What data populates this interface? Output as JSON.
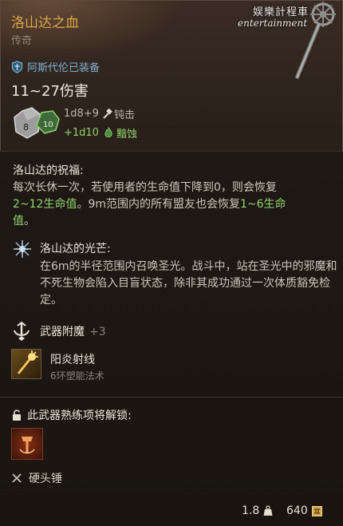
{
  "item": {
    "name": "洛山达之血",
    "rarity": "传奇",
    "equipped_text": "阿斯代伦已装备",
    "damage_range": "11~27伤害",
    "damage_lines": [
      {
        "dice": "1d8+9",
        "type": "钝击",
        "icon": "hammer-icon"
      },
      {
        "dice": "+1d10",
        "type": "黯蚀",
        "icon": "necrotic-flame-icon"
      }
    ]
  },
  "watermark": {
    "line1": "娱樂計程車",
    "line2": "entertainment"
  },
  "blessing": {
    "title": "洛山达的祝福:",
    "text_1": "每次长休一次，若使用者的生命值下降到0，则会恢复",
    "heal_1": "2~12生命值",
    "text_2": "。9m范围内的所有盟友也会恢复",
    "heal_2": "1~6生命值",
    "text_3": "。"
  },
  "aura": {
    "title": "洛山达的光芒:",
    "text": "在6m的半径范围内召唤圣光。战斗中，站在圣光中的邪魔和不死生物会陷入目盲状态，除非其成功通过一次体质豁免检定。"
  },
  "enchant": {
    "label": "武器附魔",
    "bonus": "+3"
  },
  "spell": {
    "name": "阳炎射线",
    "level": "6环塑能法术"
  },
  "proficiency": {
    "title": "此武器熟练项将解锁:"
  },
  "weapon_type": {
    "label": "硬头锤"
  },
  "footer": {
    "weight": "1.8",
    "price": "640"
  },
  "colors": {
    "title": "#d9a94a",
    "heal_green": "#8fd46f",
    "equip_blue": "#7fb0cf"
  }
}
